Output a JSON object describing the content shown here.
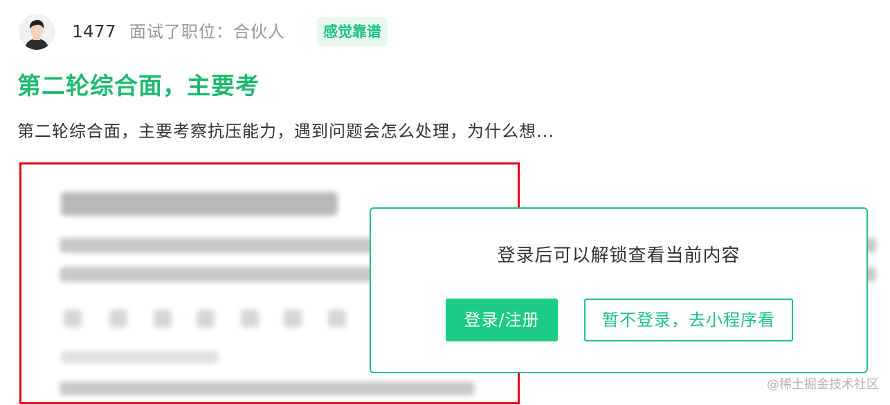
{
  "header": {
    "avatar_icon": "user-avatar-icon",
    "user_id": "1477",
    "interview_info": "面试了职位：合伙人",
    "tag": "感觉靠谱",
    "accent_color": "#1cc283"
  },
  "post": {
    "title": "第二轮综合面，主要考",
    "excerpt": "第二轮综合面，主要考察抗压能力，遇到问题会怎么处理，为什么想..."
  },
  "login_overlay": {
    "prompt": "登录后可以解锁查看当前内容",
    "login_button": "登录/注册",
    "mini_program_button": "暂不登录，去小程序看"
  },
  "watermark": "@稀土掘金技术社区",
  "annotation": {
    "color": "#e60012"
  }
}
